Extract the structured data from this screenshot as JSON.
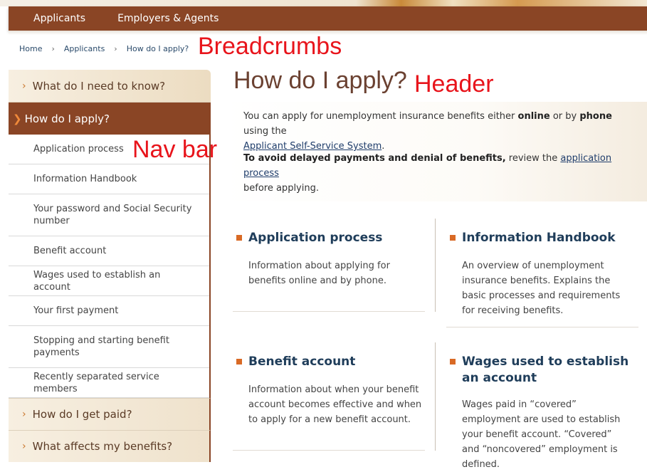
{
  "topnav": {
    "items": [
      "Applicants",
      "Employers & Agents"
    ]
  },
  "breadcrumbs": [
    "Home",
    "Applicants",
    "How do I apply?"
  ],
  "annotations": {
    "breadcrumbs": "Breadcrumbs",
    "header": "Header",
    "navbar": "Nav bar"
  },
  "page_title": "How do I apply?",
  "intro": {
    "p1_a": "You can apply for unemployment insurance benefits either ",
    "p1_online": "online",
    "p1_b": " or by ",
    "p1_phone": "phone",
    "p1_c": " using the ",
    "p1_link": "Applicant Self-Service System",
    "p1_end": ".",
    "p2_bold": "To avoid delayed payments and denial of benefits,",
    "p2_a": " review the ",
    "p2_link": "application process",
    "p2_b": " before applying."
  },
  "sidebar": {
    "top": "What do I need to know?",
    "active": "How do I apply?",
    "sub_items": [
      "Application process",
      "Information Handbook",
      "Your password and Social Security number",
      "Benefit account",
      "Wages used to establish an account",
      "Your first payment",
      "Stopping and starting benefit payments",
      "Recently separated service members"
    ],
    "bottom": [
      "How do I get paid?",
      "What affects my benefits?"
    ]
  },
  "cards": [
    {
      "title": "Application process",
      "text": "Information about applying for benefits online and by phone."
    },
    {
      "title": "Information Handbook",
      "text": "An overview of unemployment insurance benefits. Explains the basic processes and requirements for receiving benefits."
    },
    {
      "title": "Benefit account",
      "text": "Information about when your benefit account becomes effective and when to apply for a new benefit account."
    },
    {
      "title": "Wages used to establish an account",
      "text": "Wages paid in “covered” employment are used to establish your benefit account. “Covered” and “noncovered” employment is defined."
    }
  ]
}
